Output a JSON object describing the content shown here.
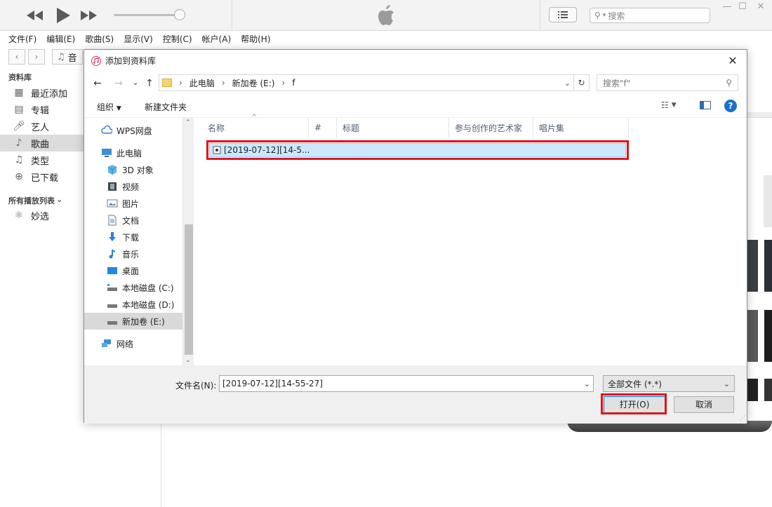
{
  "itunes": {
    "search_placeholder": "搜索",
    "menu": [
      "文件(F)",
      "编辑(E)",
      "歌曲(S)",
      "显示(V)",
      "控制(C)",
      "帐户(A)",
      "帮助(H)"
    ],
    "nav_partial_label": "音",
    "sidebar": {
      "library_header": "资料库",
      "items": [
        {
          "label": "最近添加",
          "icon": "grid-icon"
        },
        {
          "label": "专辑",
          "icon": "album-icon"
        },
        {
          "label": "艺人",
          "icon": "microphone-icon"
        },
        {
          "label": "歌曲",
          "icon": "music-note-icon",
          "active": true
        },
        {
          "label": "类型",
          "icon": "genre-icon"
        },
        {
          "label": "已下载",
          "icon": "download-icon"
        }
      ],
      "playlists_header": "所有播放列表",
      "playlist_items": [
        {
          "label": "妙选",
          "icon": "atom-icon"
        }
      ]
    }
  },
  "dialog": {
    "title": "添加到资料库",
    "breadcrumb": [
      "此电脑",
      "新加卷 (E:)",
      "f"
    ],
    "search_placeholder": "搜索\"f\"",
    "toolbar": {
      "organize": "组织",
      "new_folder": "新建文件夹"
    },
    "nav_items": [
      {
        "label": "WPS网盘",
        "icon": "cloud-icon"
      },
      {
        "label": "此电脑",
        "icon": "computer-icon"
      },
      {
        "label": "3D 对象",
        "icon": "cube-icon"
      },
      {
        "label": "视频",
        "icon": "film-icon"
      },
      {
        "label": "图片",
        "icon": "picture-icon"
      },
      {
        "label": "文档",
        "icon": "document-icon"
      },
      {
        "label": "下载",
        "icon": "download-arrow-icon"
      },
      {
        "label": "音乐",
        "icon": "music-icon"
      },
      {
        "label": "桌面",
        "icon": "desktop-icon"
      },
      {
        "label": "本地磁盘 (C:)",
        "icon": "drive-icon"
      },
      {
        "label": "本地磁盘 (D:)",
        "icon": "drive-icon"
      },
      {
        "label": "新加卷 (E:)",
        "icon": "drive-icon",
        "selected": true
      },
      {
        "label": "网络",
        "icon": "network-icon"
      }
    ],
    "columns": [
      "名称",
      "#",
      "标题",
      "参与创作的艺术家",
      "唱片集"
    ],
    "files": [
      {
        "name": "[2019-07-12][14-5...",
        "selected": true
      }
    ],
    "filename_label": "文件名(N):",
    "filename_value": "[2019-07-12][14-55-27]",
    "filetype_value": "全部文件 (*.*)",
    "open_label": "打开(O)",
    "cancel_label": "取消"
  },
  "colors": {
    "highlight": "#e0141e",
    "selection": "#cce8ff"
  }
}
